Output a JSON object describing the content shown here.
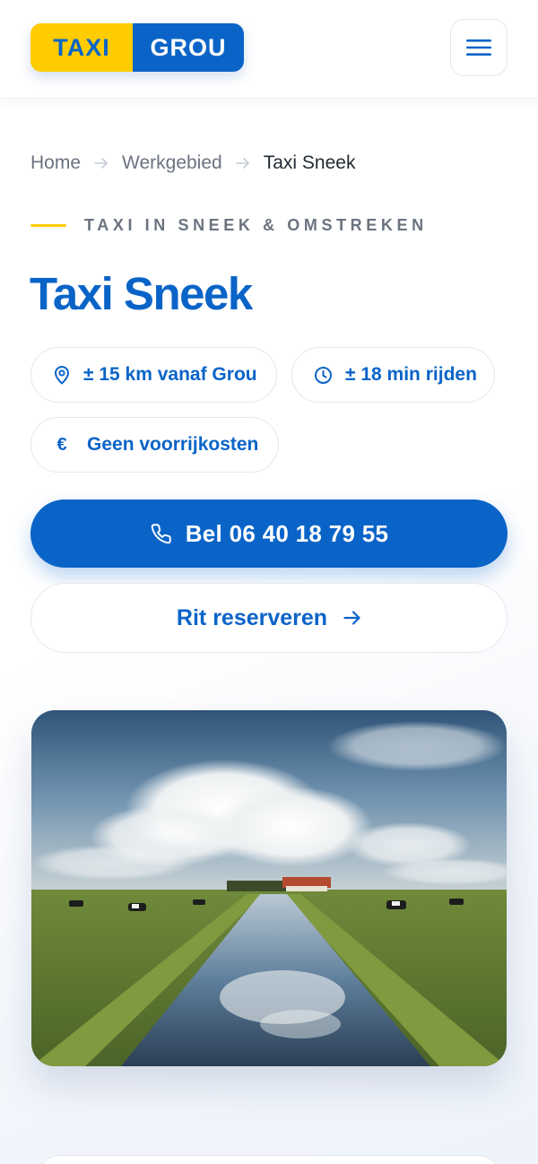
{
  "header": {
    "logo_left": "TAXI",
    "logo_right": "GROU",
    "menu_icon": "hamburger-menu-icon"
  },
  "breadcrumb": {
    "items": [
      "Home",
      "Werkgebied",
      "Taxi Sneek"
    ],
    "separator_icon": "arrow-right-icon"
  },
  "hero": {
    "eyebrow": "TAXI IN SNEEK & OMSTREKEN",
    "title": "Taxi Sneek",
    "pills": [
      {
        "icon": "location-pin-icon",
        "label": "± 15 km vanaf Grou"
      },
      {
        "icon": "clock-icon",
        "label": "± 18 min rijden"
      },
      {
        "icon": "euro-icon",
        "label": "Geen voorrijkosten"
      }
    ],
    "call_button": {
      "icon": "phone-icon",
      "label": "Bel 06 40 18 79 55"
    },
    "reserve_button": {
      "label": "Rit reserveren",
      "icon": "arrow-right-icon"
    }
  },
  "image": {
    "subject": "polder-landscape-photo"
  },
  "colors": {
    "brand_blue": "#0a64c8",
    "brand_yellow": "#ffcc00",
    "text_muted": "#6b7380"
  }
}
